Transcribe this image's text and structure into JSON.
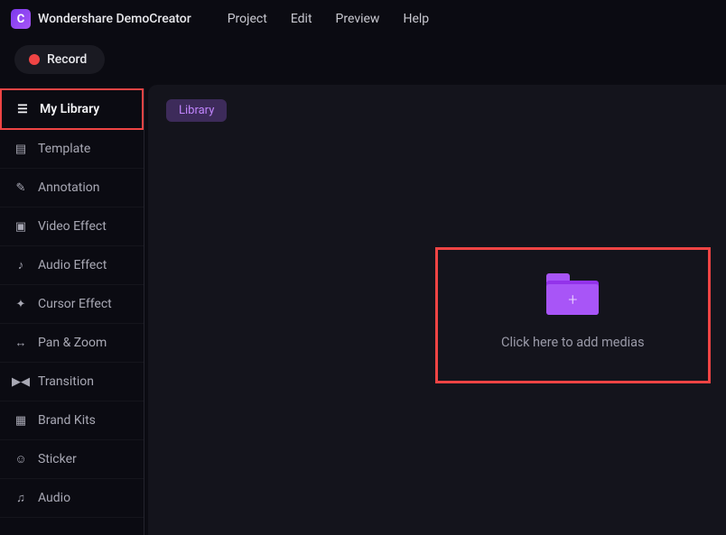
{
  "app": {
    "title": "Wondershare DemoCreator"
  },
  "menubar": {
    "items": [
      "Project",
      "Edit",
      "Preview",
      "Help"
    ]
  },
  "toolbar": {
    "record_label": "Record"
  },
  "sidebar": {
    "items": [
      {
        "icon": "layers-icon",
        "glyph": "☰",
        "label": "My Library",
        "active": true,
        "highlighted": true
      },
      {
        "icon": "template-icon",
        "glyph": "▤",
        "label": "Template"
      },
      {
        "icon": "annotation-icon",
        "glyph": "✎",
        "label": "Annotation"
      },
      {
        "icon": "video-effect-icon",
        "glyph": "▣",
        "label": "Video Effect"
      },
      {
        "icon": "audio-effect-icon",
        "glyph": "♪",
        "label": "Audio Effect"
      },
      {
        "icon": "cursor-effect-icon",
        "glyph": "✦",
        "label": "Cursor Effect"
      },
      {
        "icon": "pan-zoom-icon",
        "glyph": "↔",
        "label": "Pan & Zoom"
      },
      {
        "icon": "transition-icon",
        "glyph": "▶◀",
        "label": "Transition"
      },
      {
        "icon": "brand-kits-icon",
        "glyph": "▦",
        "label": "Brand Kits"
      },
      {
        "icon": "sticker-icon",
        "glyph": "☺",
        "label": "Sticker"
      },
      {
        "icon": "audio-icon",
        "glyph": "♫",
        "label": "Audio"
      }
    ]
  },
  "main": {
    "tab_label": "Library",
    "dropzone_text": "Click here to add medias"
  }
}
